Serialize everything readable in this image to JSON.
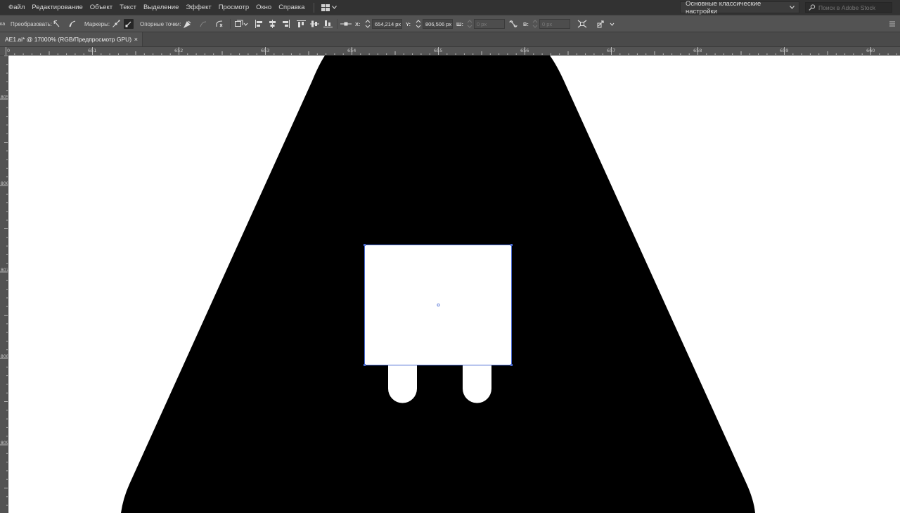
{
  "menu": {
    "items": [
      "Файл",
      "Редактирование",
      "Объект",
      "Текст",
      "Выделение",
      "Эффект",
      "Просмотр",
      "Окно",
      "Справка"
    ],
    "workspace": "Основные классические настройки",
    "stock_search_placeholder": "Поиск в Adobe Stock"
  },
  "control": {
    "cut_label": "ка",
    "convert_label": "Преобразовать:",
    "handles_label": "Маркеры:",
    "anchors_label": "Опорные точки:",
    "x_label": "X:",
    "x_value": "654,214 px",
    "y_label": "Y:",
    "y_value": "806,506 px",
    "w_label": "Ш:",
    "w_value": "0 px",
    "h_label": "В:",
    "h_value": "0 px"
  },
  "document": {
    "tab_title": "AE1.ai* @ 17000% (RGB/Предпросмотр GPU)",
    "close_glyph": "×"
  },
  "rulers": {
    "top_labels": [
      "0",
      "651",
      "652",
      "653",
      "654",
      "655",
      "656",
      "657",
      "658",
      "659",
      "660"
    ],
    "left_labels": [
      "805",
      "806",
      "807",
      "808",
      "809"
    ]
  },
  "colors": {
    "accent_selection": "#4a6cd4",
    "shape_fill": "#000000",
    "canvas_bg": "#ffffff",
    "ui_bg": "#535353",
    "menubar_bg": "#323232"
  }
}
